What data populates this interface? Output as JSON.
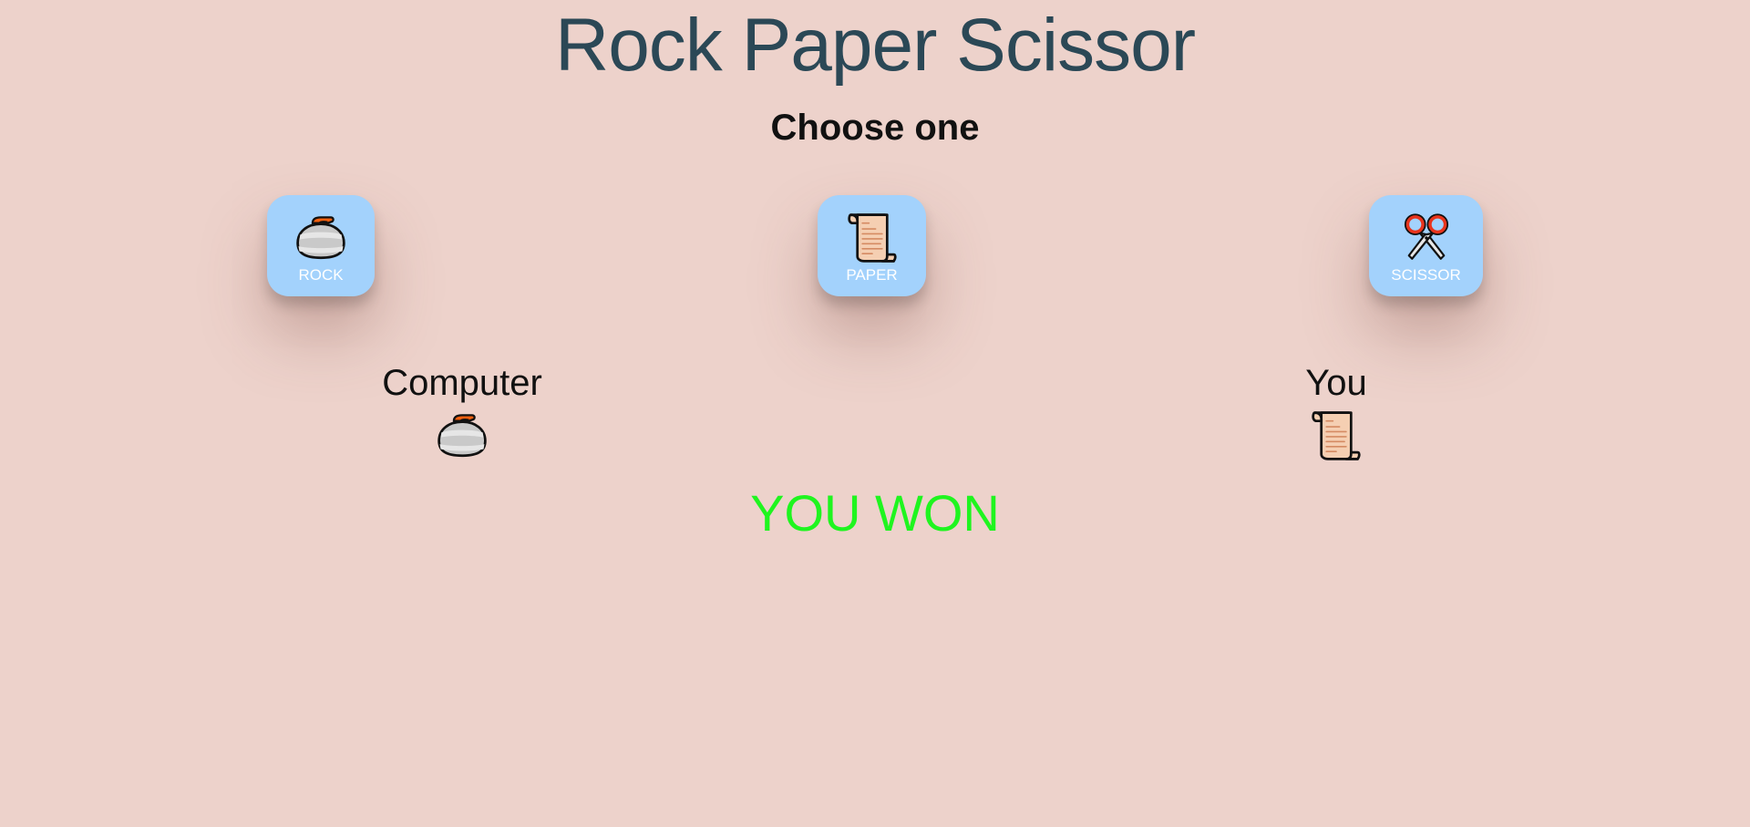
{
  "app": {
    "title": "Rock Paper Scissor",
    "subtitle": "Choose one"
  },
  "choices": [
    {
      "label": "ROCK",
      "icon": "curling-stone-icon"
    },
    {
      "label": "PAPER",
      "icon": "scroll-icon"
    },
    {
      "label": "SCISSOR",
      "icon": "scissors-icon"
    }
  ],
  "computer": {
    "label": "Computer",
    "pick_icon": "curling-stone-icon"
  },
  "you": {
    "label": "You",
    "pick_icon": "scroll-icon"
  },
  "result": {
    "text": "YOU WON",
    "color": "#1ff51f"
  },
  "colors": {
    "background": "#edd2cb",
    "title": "#2b4856",
    "button": "#a3d2fc",
    "button_text": "#ffffff"
  }
}
